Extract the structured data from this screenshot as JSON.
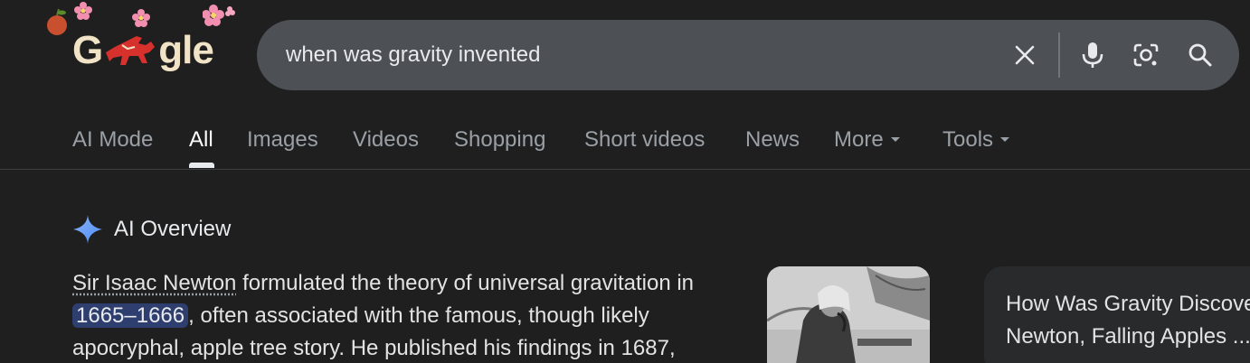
{
  "logo": {
    "text_left": "G",
    "text_right": "gle"
  },
  "search": {
    "query": "when was gravity invented"
  },
  "icons": {
    "clear": "close-icon",
    "voice": "mic-icon",
    "lens": "camera-lens-icon",
    "search": "search-icon"
  },
  "tabs": [
    {
      "label": "AI Mode"
    },
    {
      "label": "All"
    },
    {
      "label": "Images"
    },
    {
      "label": "Videos"
    },
    {
      "label": "Shopping"
    },
    {
      "label": "Short videos"
    },
    {
      "label": "News"
    },
    {
      "label": "More"
    },
    {
      "label": "Tools"
    }
  ],
  "ai_overview": {
    "title": "AI Overview",
    "link_name": "Sir Isaac Newton",
    "text_1": " formulated the theory of universal gravitation in",
    "highlight": "1665–1666",
    "text_2": ", often associated with the famous, though likely apocryphal, apple tree story. He published his findings in 1687,"
  },
  "side_card": {
    "title": "How Was Gravity Discove\nNewton, Falling Apples ..."
  }
}
